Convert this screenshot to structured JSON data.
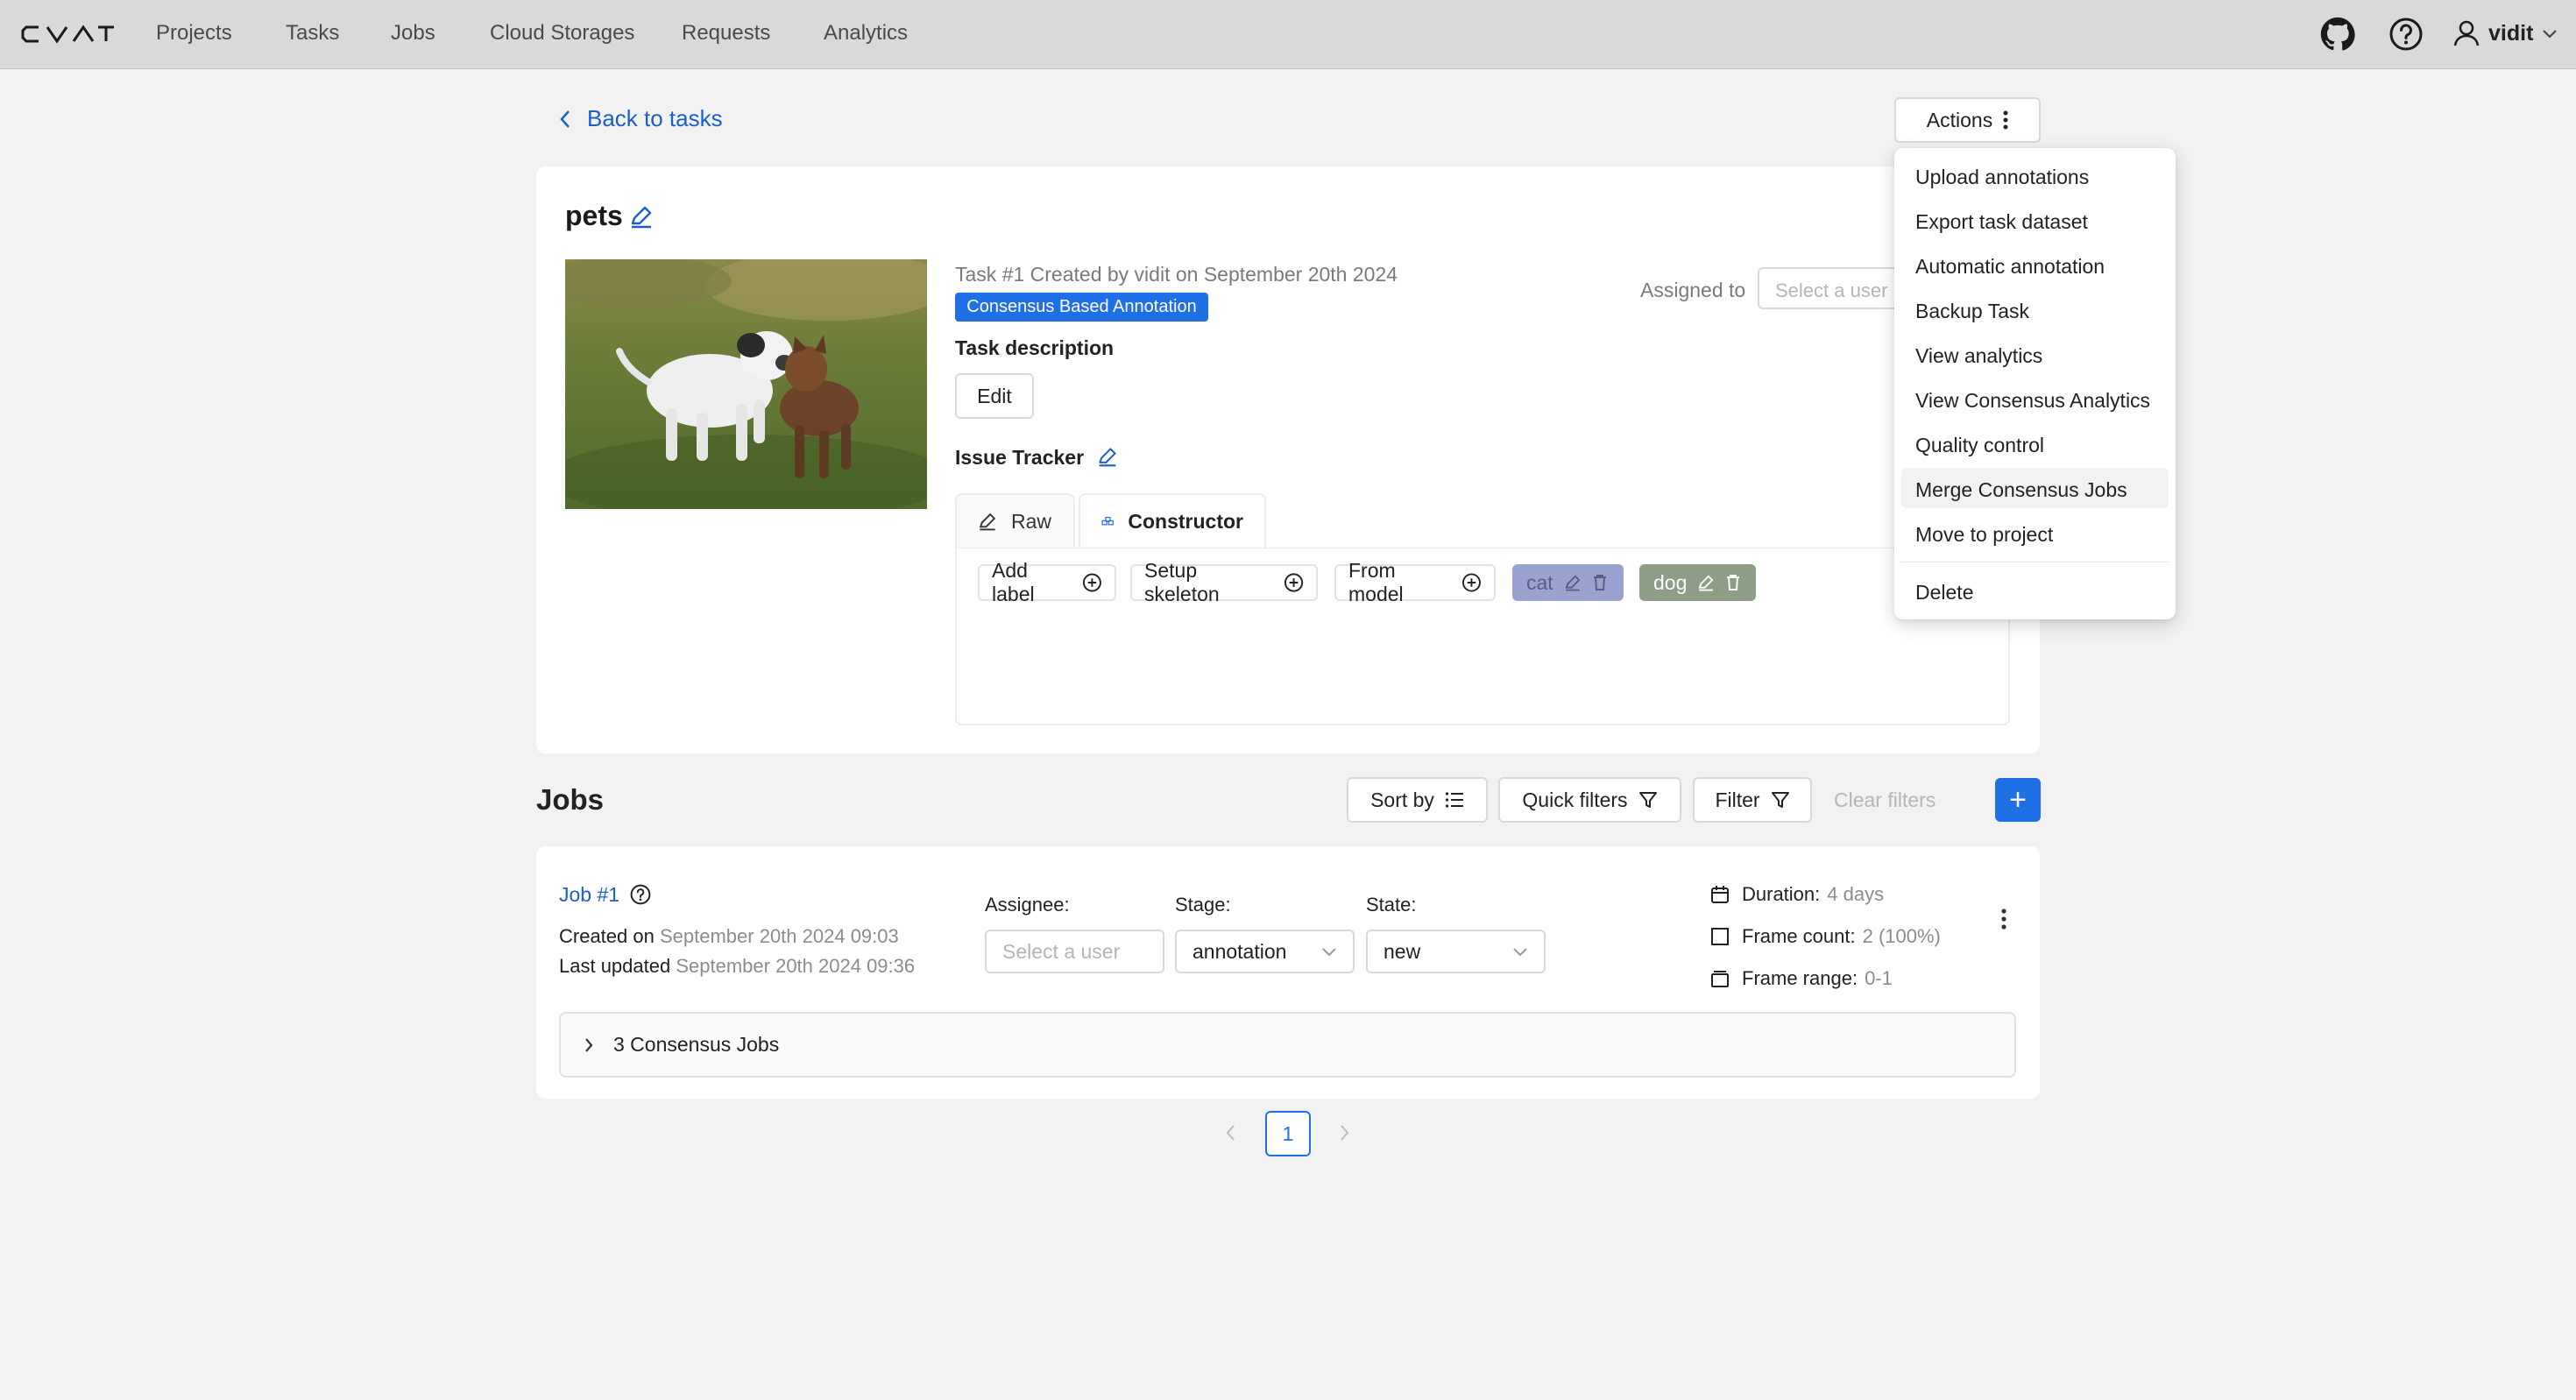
{
  "app": {
    "logo_text": "CVAT"
  },
  "nav": [
    "Projects",
    "Tasks",
    "Jobs",
    "Cloud Storages",
    "Requests",
    "Analytics"
  ],
  "user": {
    "name": "vidit"
  },
  "back_link": "Back to tasks",
  "actions": {
    "label": "Actions",
    "menu": [
      "Upload annotations",
      "Export task dataset",
      "Automatic annotation",
      "Backup Task",
      "View analytics",
      "View Consensus Analytics",
      "Quality control",
      "Merge Consensus Jobs",
      "Move to project"
    ],
    "delete_label": "Delete",
    "highlighted": "Merge Consensus Jobs"
  },
  "task": {
    "name": "pets",
    "meta": "Task #1 Created by vidit on September 20th 2024",
    "tag": "Consensus Based Annotation",
    "description_label": "Task description",
    "edit_label": "Edit",
    "issue_tracker_label": "Issue Tracker",
    "assigned_to_label": "Assigned to",
    "assignee_placeholder": "Select a user"
  },
  "label_editor": {
    "tabs": [
      "Raw",
      "Constructor"
    ],
    "active_tab": "Constructor",
    "add_label": "Add label",
    "setup_skeleton": "Setup skeleton",
    "from_model": "From model",
    "labels": [
      {
        "name": "cat",
        "color": "#9aa3cf"
      },
      {
        "name": "dog",
        "color": "#8e9e86"
      }
    ]
  },
  "jobs": {
    "title": "Jobs",
    "sort_by": "Sort by",
    "quick_filters": "Quick filters",
    "filter": "Filter",
    "clear_filters": "Clear filters",
    "add_button": "+",
    "items": [
      {
        "name": "Job #1",
        "created_label": "Created on",
        "created": "September 20th 2024 09:03",
        "updated_label": "Last updated",
        "updated": "September 20th 2024 09:36",
        "assignee_label": "Assignee:",
        "assignee_placeholder": "Select a user",
        "stage_label": "Stage:",
        "stage": "annotation",
        "state_label": "State:",
        "state": "new",
        "duration_label": "Duration:",
        "duration": "4 days",
        "frame_count_label": "Frame count:",
        "frame_count": "2 (100%)",
        "frame_range_label": "Frame range:",
        "frame_range": "0-1",
        "consensus": "3 Consensus Jobs"
      }
    ]
  },
  "pagination": {
    "current": "1"
  },
  "colors": {
    "accent": "#1f6fe5",
    "link": "#1d5fc7"
  }
}
